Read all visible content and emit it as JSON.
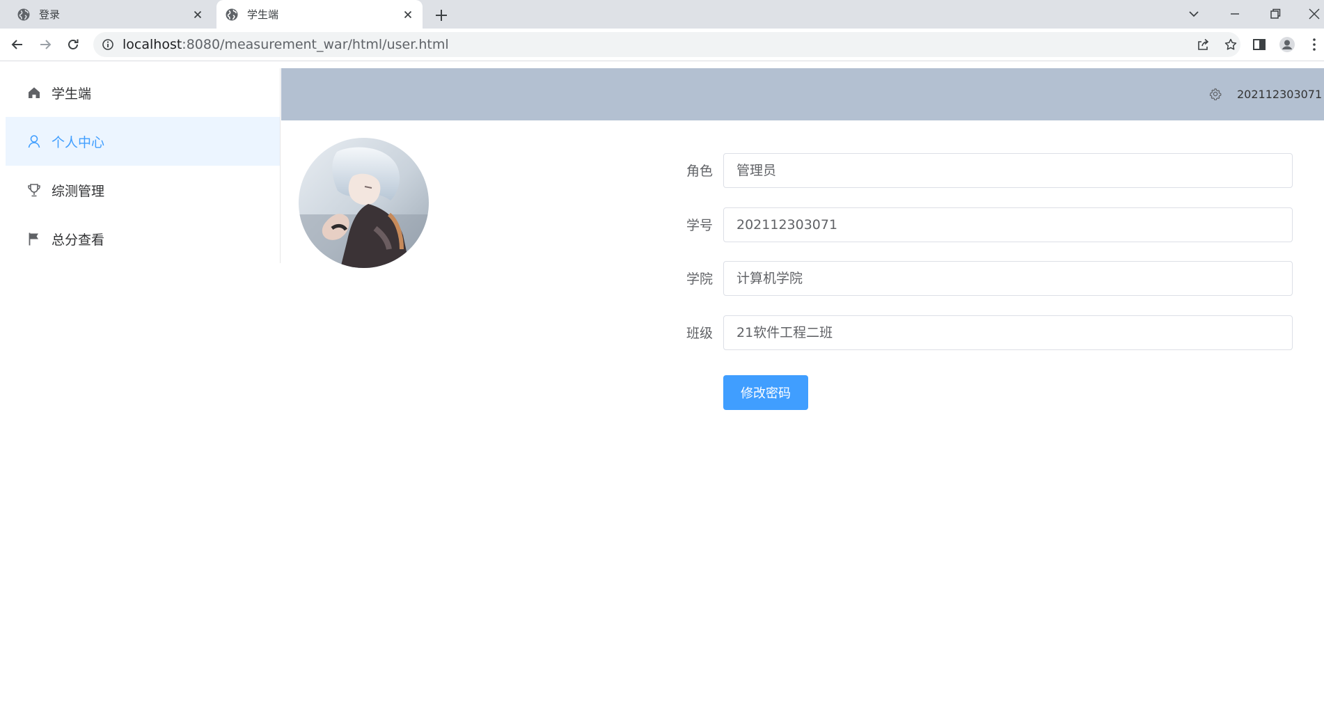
{
  "browser": {
    "tabs": [
      {
        "title": "登录",
        "active": false
      },
      {
        "title": "学生端",
        "active": true
      }
    ],
    "url": {
      "host": "localhost",
      "path": ":8080/measurement_war/html/user.html"
    }
  },
  "header": {
    "username": "202112303071"
  },
  "sidebar": {
    "items": [
      {
        "label": "学生端",
        "icon": "home-icon",
        "active": false
      },
      {
        "label": "个人中心",
        "icon": "user-icon",
        "active": true
      },
      {
        "label": "综测管理",
        "icon": "trophy-icon",
        "active": false
      },
      {
        "label": "总分查看",
        "icon": "flag-icon",
        "active": false
      }
    ]
  },
  "form": {
    "fields": [
      {
        "label": "角色",
        "value": "管理员"
      },
      {
        "label": "学号",
        "value": "202112303071"
      },
      {
        "label": "学院",
        "value": "计算机学院"
      },
      {
        "label": "班级",
        "value": "21软件工程二班"
      }
    ],
    "change_password_label": "修改密码"
  },
  "colors": {
    "accent": "#409eff",
    "menu_active_bg": "#ecf5ff",
    "header_bg": "#b3c0d1",
    "tabbar_bg": "#dee1e6"
  }
}
